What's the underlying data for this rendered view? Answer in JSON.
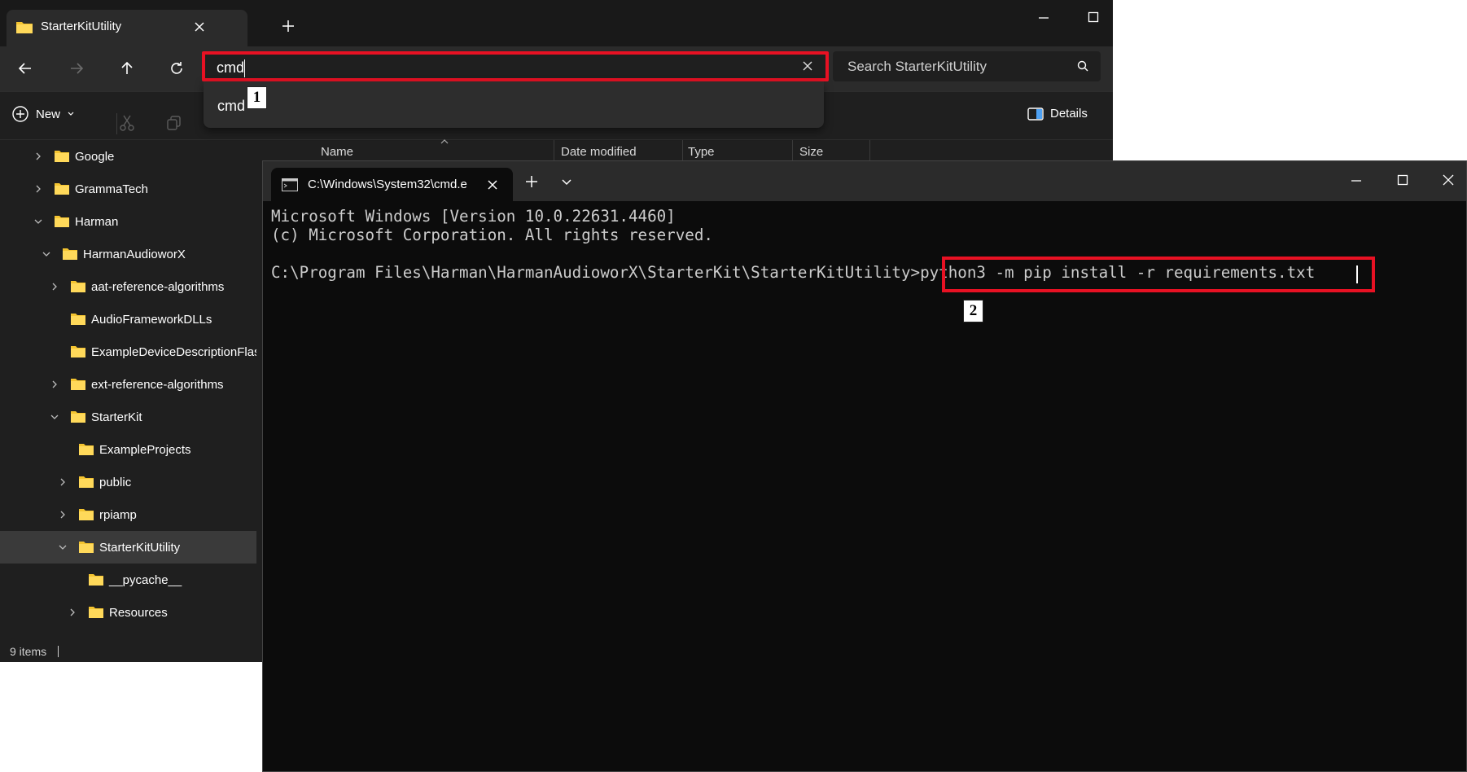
{
  "explorer": {
    "tab_title": "StarterKitUtility",
    "address": {
      "value": "cmd"
    },
    "suggestion": "cmd",
    "search": {
      "placeholder": "Search StarterKitUtility"
    },
    "toolbar": {
      "new_label": "New",
      "details_label": "Details"
    },
    "tree": [
      {
        "label": "Google",
        "expander": "collapsed",
        "selected": false
      },
      {
        "label": "GrammaTech",
        "expander": "collapsed",
        "selected": false
      },
      {
        "label": "Harman",
        "expander": "expanded",
        "selected": false
      },
      {
        "label": "HarmanAudioworX",
        "expander": "expanded",
        "selected": false
      },
      {
        "label": "aat-reference-algorithms",
        "expander": "collapsed",
        "selected": false
      },
      {
        "label": "AudioFrameworkDLLs",
        "expander": "none",
        "selected": false
      },
      {
        "label": "ExampleDeviceDescriptionFlas",
        "expander": "none",
        "selected": false
      },
      {
        "label": "ext-reference-algorithms",
        "expander": "collapsed",
        "selected": false
      },
      {
        "label": "StarterKit",
        "expander": "expanded",
        "selected": false
      },
      {
        "label": "ExampleProjects",
        "expander": "none",
        "selected": false
      },
      {
        "label": "public",
        "expander": "collapsed",
        "selected": false
      },
      {
        "label": "rpiamp",
        "expander": "collapsed",
        "selected": false
      },
      {
        "label": "StarterKitUtility",
        "expander": "expanded",
        "selected": true
      },
      {
        "label": "__pycache__",
        "expander": "none",
        "selected": false
      },
      {
        "label": "Resources",
        "expander": "collapsed",
        "selected": false
      }
    ],
    "columns": [
      "Name",
      "Date modified",
      "Type",
      "Size"
    ],
    "status": "9 items"
  },
  "terminal": {
    "tab_title": "C:\\Windows\\System32\\cmd.e",
    "lines": [
      "Microsoft Windows [Version 10.0.22631.4460]",
      "(c) Microsoft Corporation. All rights reserved.",
      "",
      "C:\\Program Files\\Harman\\HarmanAudioworX\\StarterKit\\StarterKitUtility>python3 -m pip install -r requirements.txt"
    ]
  },
  "annotations": [
    "1",
    "2"
  ],
  "colors": {
    "highlight": "#e81123",
    "folder": "#f4c430",
    "explorer_bg": "#1f1f1f",
    "terminal_bg": "#0c0c0c"
  }
}
